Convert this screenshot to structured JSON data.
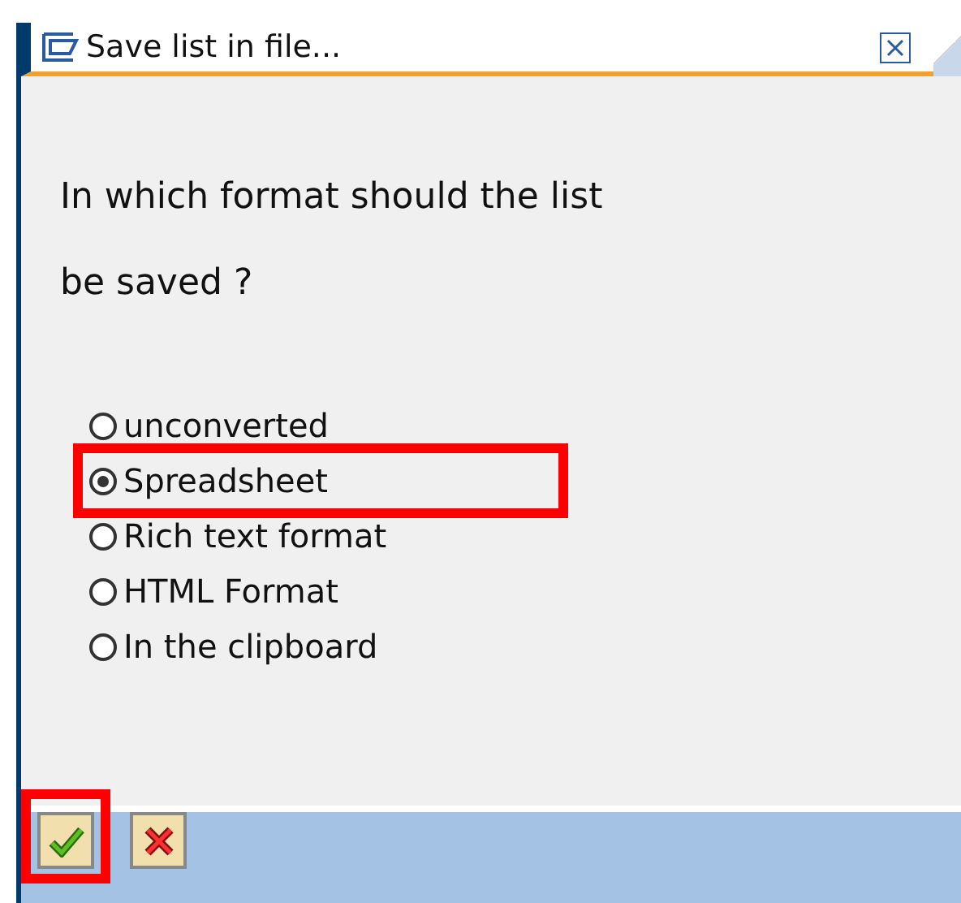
{
  "window": {
    "title": "Save list in file..."
  },
  "question": [
    "In which format should the list",
    "be saved ?"
  ],
  "options": [
    {
      "label": "unconverted",
      "selected": false,
      "highlighted": false
    },
    {
      "label": "Spreadsheet",
      "selected": true,
      "highlighted": true
    },
    {
      "label": "Rich text format",
      "selected": false,
      "highlighted": false
    },
    {
      "label": "HTML Format",
      "selected": false,
      "highlighted": false
    },
    {
      "label": "In the clipboard",
      "selected": false,
      "highlighted": false
    }
  ],
  "buttons": [
    {
      "kind": "confirm",
      "highlighted": true
    },
    {
      "kind": "cancel",
      "highlighted": false
    }
  ]
}
